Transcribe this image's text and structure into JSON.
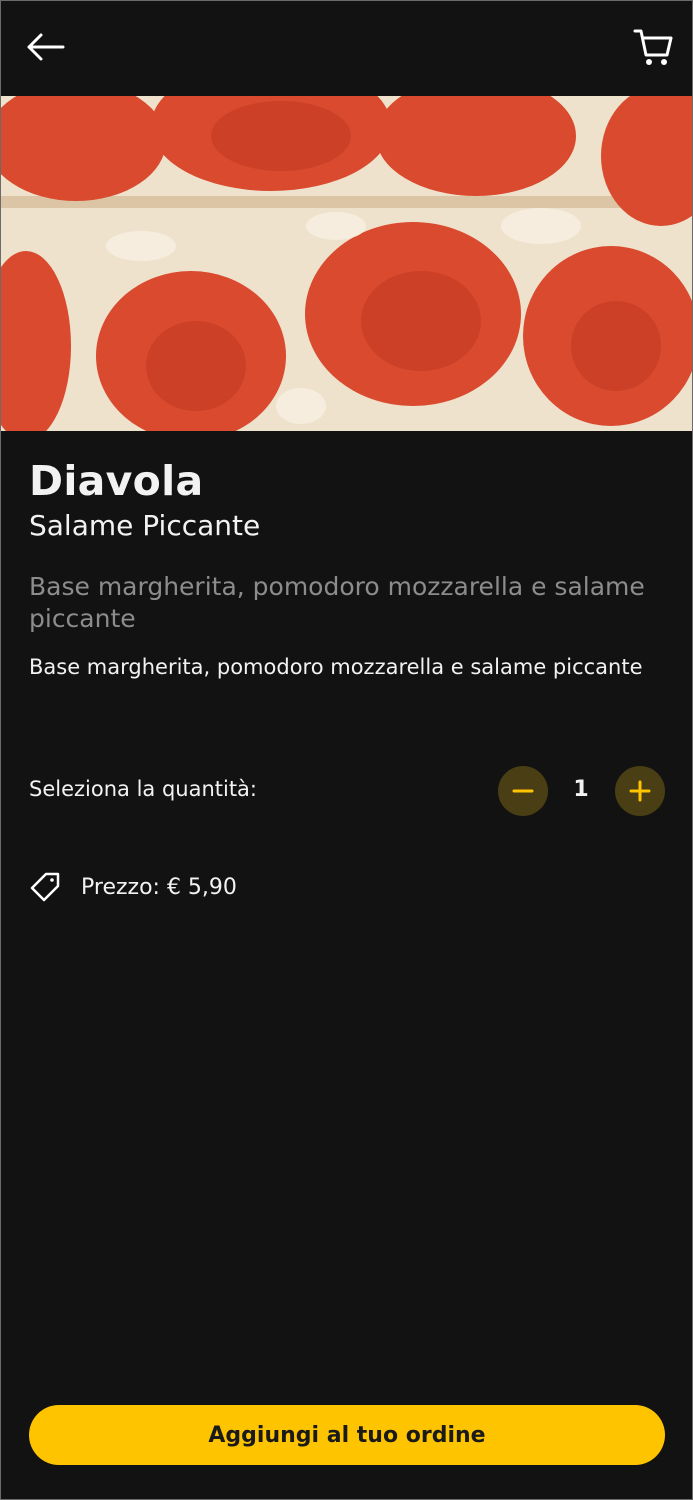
{
  "header": {
    "back_icon": "arrow-left-icon",
    "cart_icon": "shopping-cart-icon"
  },
  "product": {
    "name": "Diavola",
    "subtitle": "Salame Piccante",
    "description_muted": "Base margherita, pomodoro mozzarella e salame piccante",
    "description": "Base margherita, pomodoro mozzarella e salame piccante"
  },
  "quantity": {
    "label": "Seleziona la quantità:",
    "value": "1",
    "minus_icon": "minus-icon",
    "plus_icon": "plus-icon"
  },
  "price": {
    "icon": "price-tag-icon",
    "text": "Prezzo: € 5,90"
  },
  "cta": {
    "label": "Aggiungi al tuo ordine"
  },
  "colors": {
    "background": "#121212",
    "accent": "#ffc400",
    "accent_dark": "#4a3e14",
    "muted_text": "#8c8c8c"
  }
}
